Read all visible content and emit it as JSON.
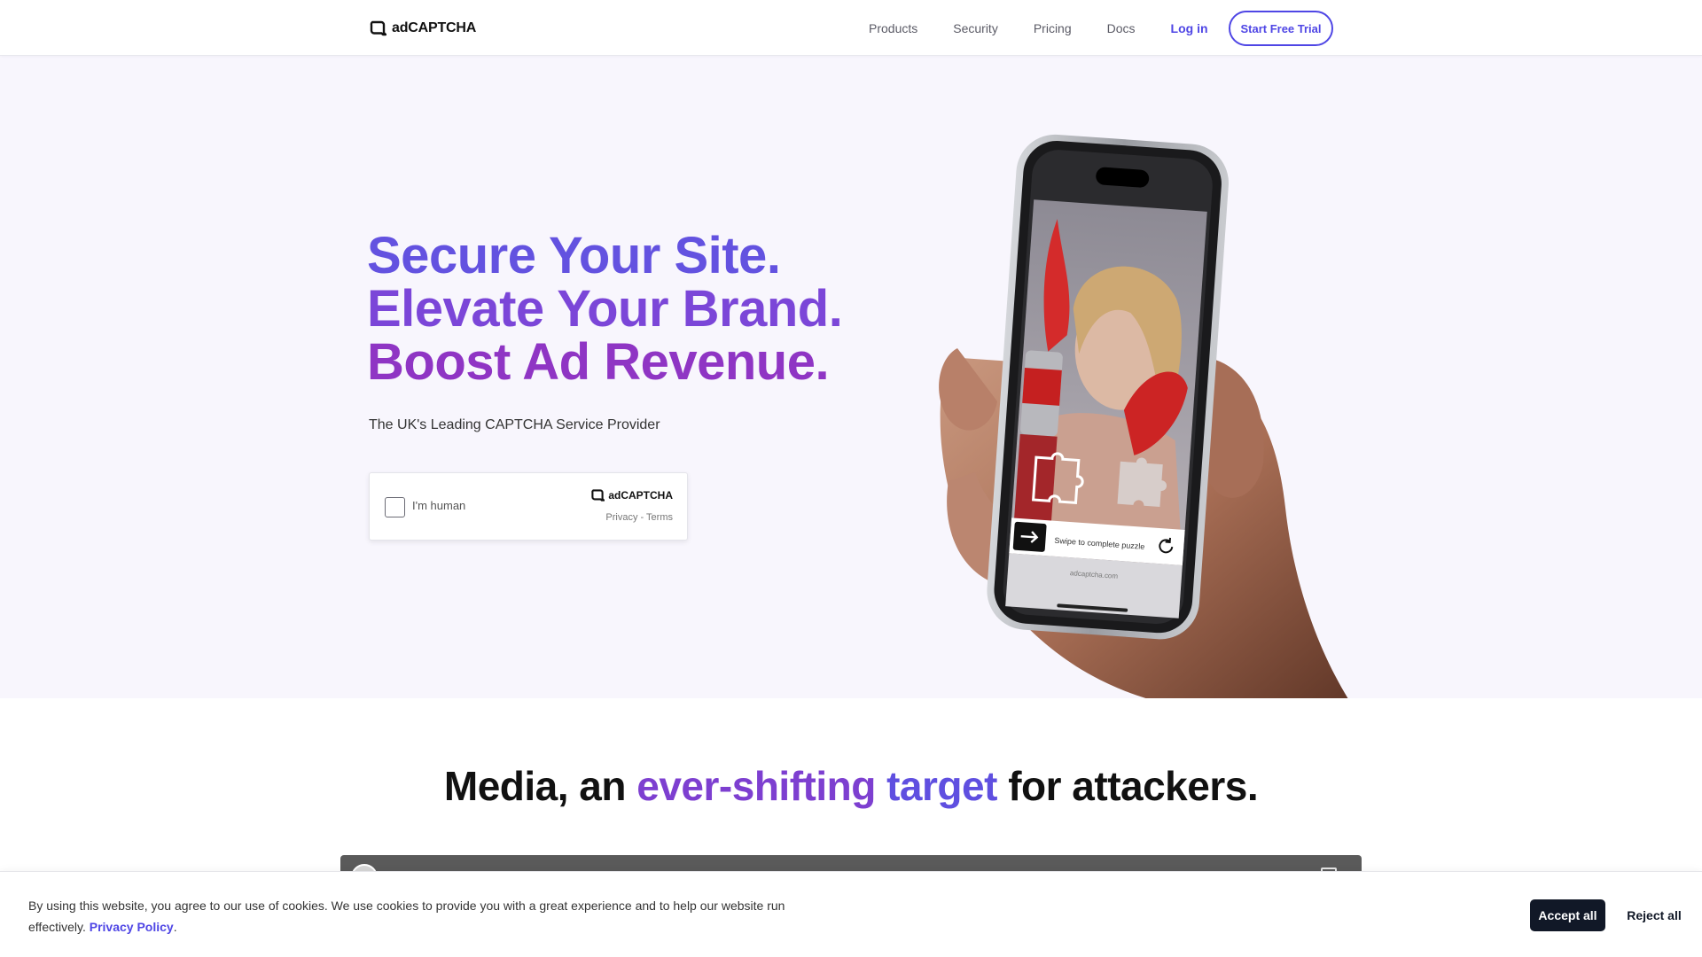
{
  "header": {
    "brand": "adCAPTCHA",
    "nav": [
      "Products",
      "Security",
      "Pricing",
      "Docs"
    ],
    "login_label": "Log in",
    "trial_label": "Start Free Trial",
    "accent_color": "#4f46e5"
  },
  "hero": {
    "headline": [
      "Secure Your Site.",
      "Elevate Your Brand.",
      "Boost Ad Revenue."
    ],
    "subhead": "The UK's Leading CAPTCHA Service Provider",
    "widget": {
      "checkbox_label": "I'm human",
      "brand": "adCAPTCHA",
      "privacy_label": "Privacy",
      "separator": "-",
      "terms_label": "Terms"
    },
    "phone": {
      "swipe_label": "Swipe to complete puzzle",
      "url_label": "adcaptcha.com"
    }
  },
  "section": {
    "title_start": "Media, an",
    "title_highlight_1": "ever-shifting",
    "title_highlight_2": "target",
    "title_end": "for attackers."
  },
  "cookie": {
    "text": "By using this website, you agree to our use of cookies. We use cookies to provide you with a great experience and to help our website run effectively.",
    "link_label": "Privacy Policy",
    "link_suffix": ".",
    "accept_label": "Accept all",
    "reject_label": "Reject all"
  },
  "icons": {
    "logo": "adcaptcha-logo-icon",
    "arrow": "arrow-right-icon",
    "refresh": "refresh-icon",
    "puzzle": "puzzle-piece-icon"
  }
}
